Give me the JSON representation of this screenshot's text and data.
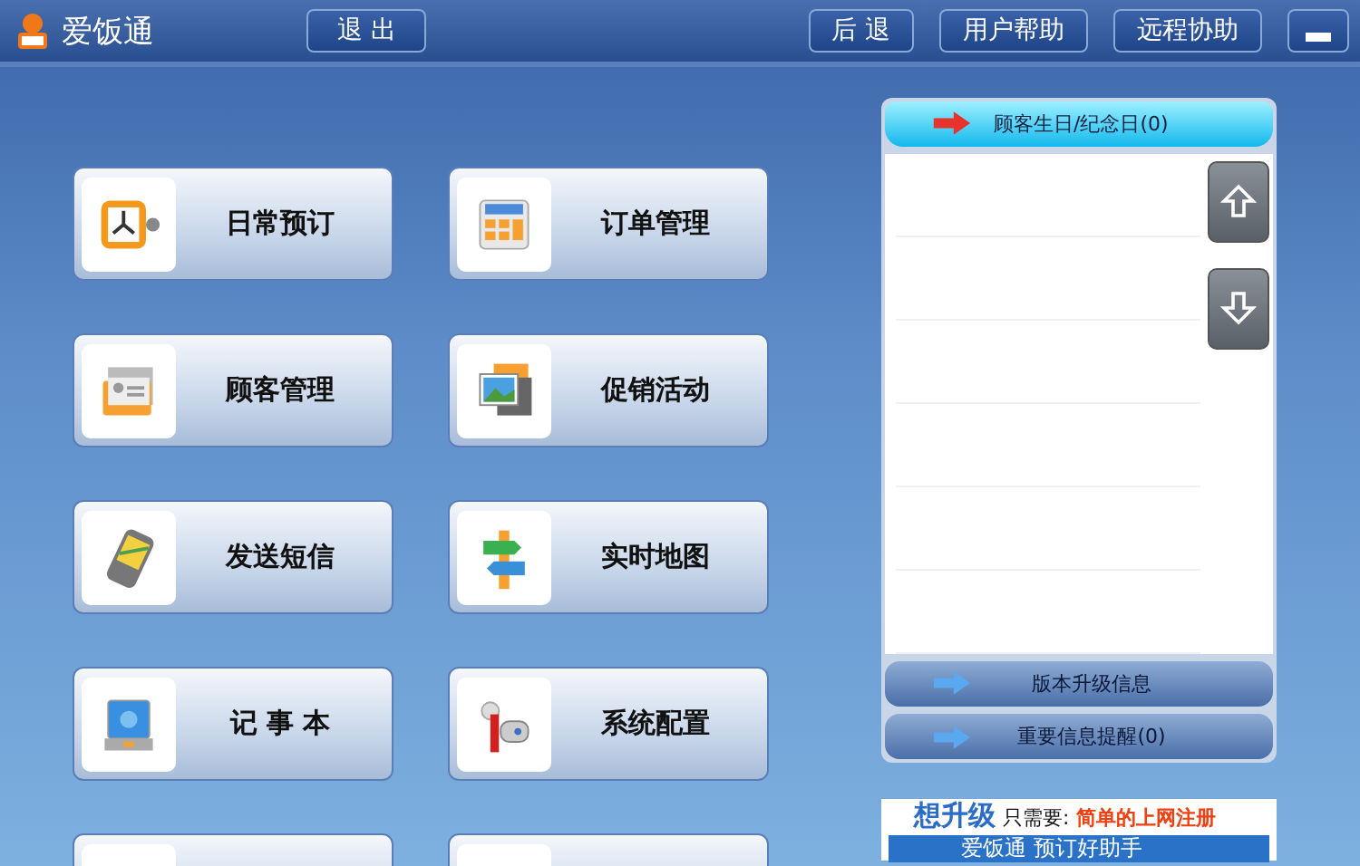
{
  "app": {
    "title": "爱饭通"
  },
  "top_buttons": [
    {
      "label": "退 出",
      "kind": "left"
    },
    {
      "label": "后 退",
      "kind": "right"
    },
    {
      "label": "用户帮助",
      "kind": "right"
    },
    {
      "label": "远程协助",
      "kind": "right"
    },
    {
      "kind": "minimize"
    }
  ],
  "tiles": [
    {
      "label": "日常预订"
    },
    {
      "label": "订单管理"
    },
    {
      "label": "顾客管理"
    },
    {
      "label": "促销活动"
    },
    {
      "label": "发送短信"
    },
    {
      "label": "实时地图"
    },
    {
      "label": "记 事 本"
    },
    {
      "label": "系统配置"
    }
  ],
  "reminders": {
    "header": "顾客生日/纪念日(0)",
    "buttons": [
      "版本升级信息",
      "重要信息提醒(0)"
    ]
  },
  "banner": {
    "title": "想升级",
    "middle": "只需要:",
    "highlight": "简单的上网注册",
    "subtitle": "爱饭通 预订好助手"
  }
}
